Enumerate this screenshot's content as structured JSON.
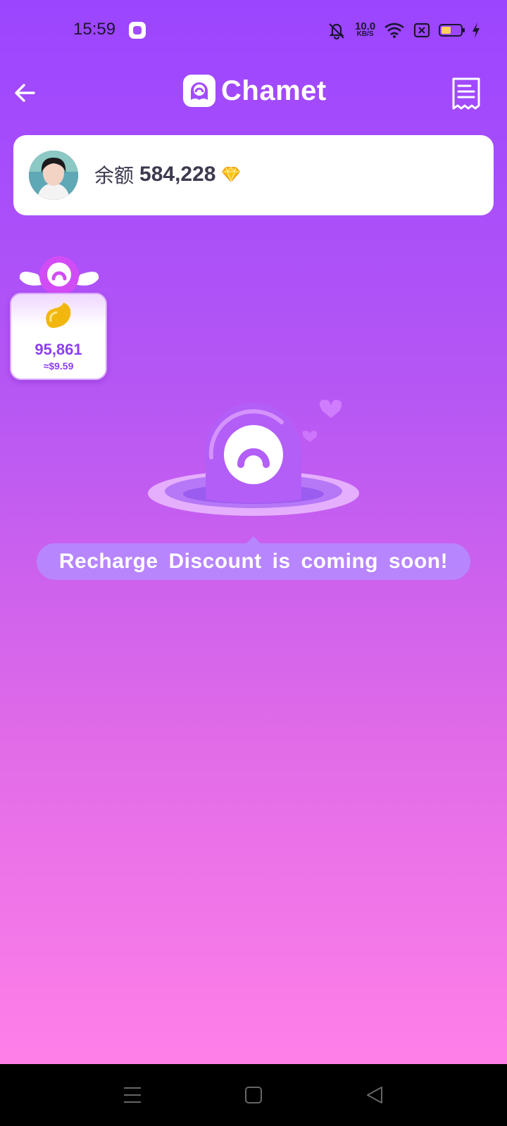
{
  "status_bar": {
    "time": "15:59",
    "network_speed": "10.0",
    "network_unit": "KB/S",
    "icons": [
      "app-notification-icon",
      "mute-icon",
      "wifi-icon",
      "sim-off-icon",
      "battery-icon",
      "charging-icon"
    ],
    "battery_level": 0.5
  },
  "header": {
    "app_name": "Chamet",
    "back_icon": "back-arrow-icon",
    "records_icon": "receipt-icon"
  },
  "balance": {
    "label": "余额",
    "value": "584,228",
    "currency_icon": "diamond-icon"
  },
  "beans": {
    "value": "95,861",
    "usd": "≈$9.59",
    "icon": "bean-icon"
  },
  "promo": {
    "message": "Recharge Discount is coming soon!"
  },
  "colors": {
    "accent": "#9b45ff",
    "text_dark": "#3c3a4e",
    "beans_text": "#8d3ff0"
  },
  "nav_bar": {
    "buttons": [
      "menu-icon",
      "home-icon",
      "back-triangle-icon"
    ]
  }
}
